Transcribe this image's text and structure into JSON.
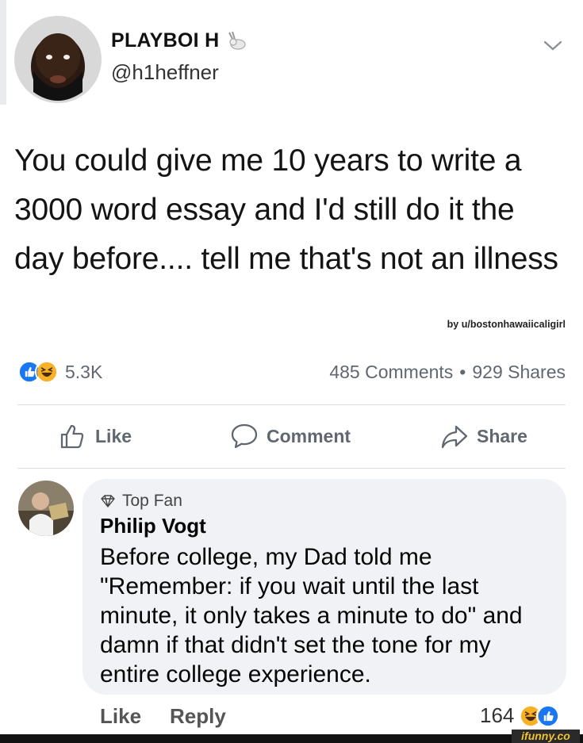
{
  "tweet": {
    "display_name": "PLAYBOI H",
    "handle": "@h1heffner",
    "text": "You could give me 10 years to write a 3000 word essay and I'd still do it the day before.... tell me that's not an illness"
  },
  "credit": "by u/bostonhawaiicaligirl",
  "post_stats": {
    "reaction_count": "5.3K",
    "comments": "485 Comments",
    "separator": "•",
    "shares": "929 Shares"
  },
  "actions": {
    "like": "Like",
    "comment": "Comment",
    "share": "Share"
  },
  "comment": {
    "badge": "Top Fan",
    "author": "Philip Vogt",
    "text": "Before college, my Dad told me \"Remember: if you wait until the last minute, it only takes a minute to do\" and damn if that didn't set the tone for my entire college experience.",
    "like": "Like",
    "reply": "Reply",
    "reaction_count": "164"
  },
  "watermark": "ifunny.co",
  "icons": {
    "reactions": [
      "like-reaction-icon",
      "haha-reaction-icon"
    ],
    "actions": [
      "thumbs-up-icon",
      "speech-bubble-icon",
      "share-arrow-icon"
    ],
    "header": [
      "rabbit-icon",
      "chevron-down-icon"
    ],
    "badge": "diamond-icon"
  },
  "colors": {
    "like_blue": "#1877f2",
    "haha_yellow": "#f7b125",
    "muted_text": "#606770",
    "bubble_bg": "#f0f2f5"
  }
}
